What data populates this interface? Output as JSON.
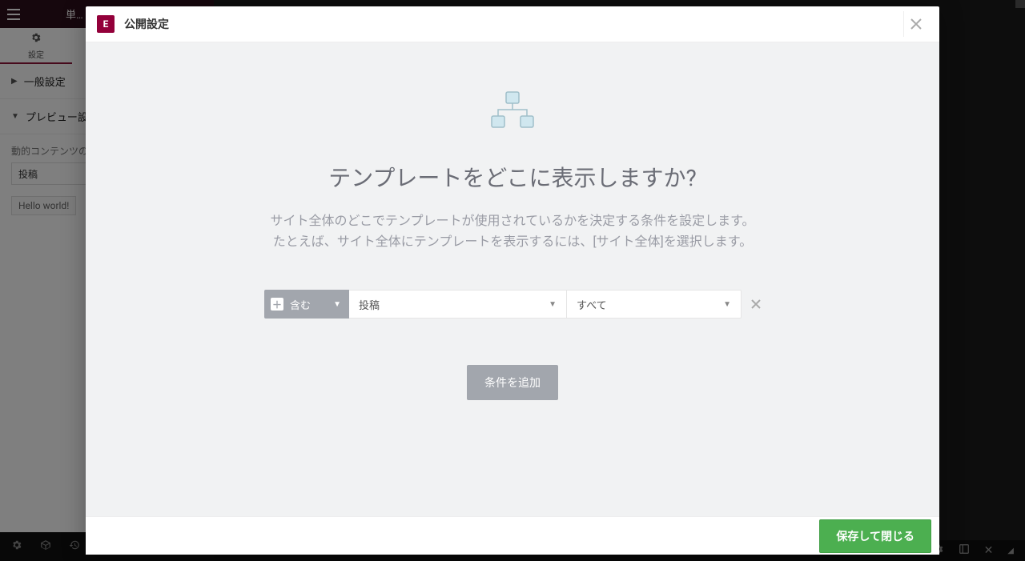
{
  "editor": {
    "topbar_title": "単…",
    "sidebar_tab_label": "設定",
    "section_general": "一般設定",
    "section_preview": "プレビュー設…",
    "field_dynamic_label": "動的コンテンツの…",
    "field_dynamic_value": "投稿",
    "tag_value": "Hello world!"
  },
  "modal": {
    "logo_text": "E",
    "title": "公開設定",
    "heading": "テンプレートをどこに表示しますか?",
    "description_line1": "サイト全体のどこでテンプレートが使用されているかを決定する条件を設定します。",
    "description_line2": "たとえば、サイト全体にテンプレートを表示するには、[サイト全体]を選択します。",
    "condition": {
      "include_label": "含む",
      "select1": "投稿",
      "select2": "すべて"
    },
    "add_condition_label": "条件を追加",
    "save_button": "保存して閉じる"
  }
}
